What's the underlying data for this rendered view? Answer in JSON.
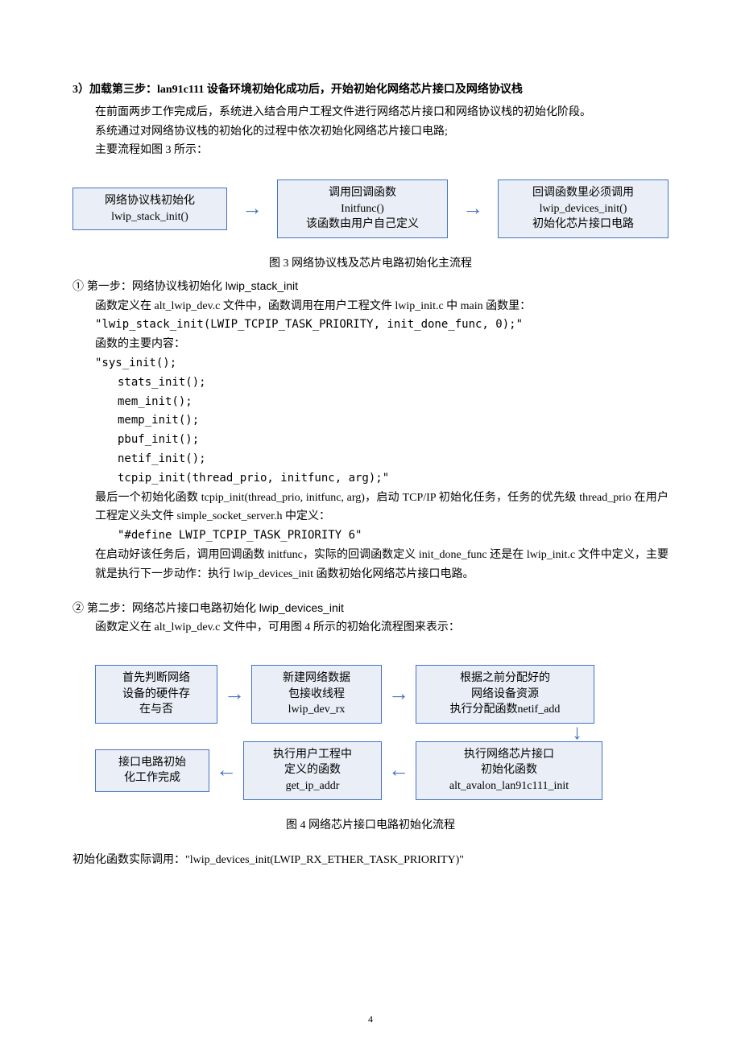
{
  "heading3": "3）加载第三步：lan91c111 设备环境初始化成功后，开始初始化网络芯片接口及网络协议栈",
  "p1": "在前面两步工作完成后，系统进入结合用户工程文件进行网络芯片接口和网络协议栈的初始化阶段。",
  "p2": "系统通过对网络协议栈的初始化的过程中依次初始化网络芯片接口电路;",
  "p3": "主要流程如图 3 所示：",
  "diag3": {
    "b1l1": "网络协议栈初始化",
    "b1l2": "lwip_stack_init()",
    "b2l1": "调用回调函数",
    "b2l2": "Initfunc()",
    "b2l3": "该函数由用户自己定义",
    "b3l1": "回调函数里必须调用",
    "b3l2": "lwip_devices_init()",
    "b3l3": "初始化芯片接口电路"
  },
  "cap3": "图 3 网络协议栈及芯片电路初始化主流程",
  "s1": {
    "t": "① 第一步：网络协议栈初始化 lwip_stack_init",
    "l1": "函数定义在 alt_lwip_dev.c 文件中，函数调用在用户工程文件 lwip_init.c 中 main 函数里：",
    "l2": "\"lwip_stack_init(LWIP_TCPIP_TASK_PRIORITY, init_done_func, 0);\"",
    "l3": "函数的主要内容：",
    "c1": "\"sys_init();",
    "c2": "stats_init();",
    "c3": "mem_init();",
    "c4": "memp_init();",
    "c5": "pbuf_init();",
    "c6": "netif_init();",
    "c7": "tcpip_init(thread_prio, initfunc, arg);\"",
    "l4": "最后一个初始化函数 tcpip_init(thread_prio, initfunc, arg)，启动 TCP/IP 初始化任务，任务的优先级 thread_prio 在用户工程定义头文件 simple_socket_server.h 中定义：",
    "l5": "\"#define LWIP_TCPIP_TASK_PRIORITY               6\"",
    "l6": "在启动好该任务后，调用回调函数 initfunc，实际的回调函数定义 init_done_func 还是在 lwip_init.c 文件中定义，主要就是执行下一步动作：执行 lwip_devices_init 函数初始化网络芯片接口电路。"
  },
  "s2": {
    "t": "② 第二步：网络芯片接口电路初始化 lwip_devices_init",
    "l1": "函数定义在 alt_lwip_dev.c 文件中，可用图 4 所示的初始化流程图来表示："
  },
  "diag4": {
    "r1b1l1": "首先判断网络",
    "r1b1l2": "设备的硬件存",
    "r1b1l3": "在与否",
    "r1b2l1": "新建网络数据",
    "r1b2l2": "包接收线程",
    "r1b2l3": "lwip_dev_rx",
    "r1b3l1": "根据之前分配好的",
    "r1b3l2": "网络设备资源",
    "r1b3l3": "执行分配函数netif_add",
    "r2b1l1": "接口电路初始",
    "r2b1l2": "化工作完成",
    "r2b2l1": "执行用户工程中",
    "r2b2l2": "定义的函数",
    "r2b2l3": "get_ip_addr",
    "r2b3l1": "执行网络芯片接口",
    "r2b3l2": "初始化函数",
    "r2b3l3": "alt_avalon_lan91c111_init"
  },
  "cap4": "图 4 网络芯片接口电路初始化流程",
  "last": "初始化函数实际调用：\"lwip_devices_init(LWIP_RX_ETHER_TASK_PRIORITY)\"",
  "pageNum": "4"
}
